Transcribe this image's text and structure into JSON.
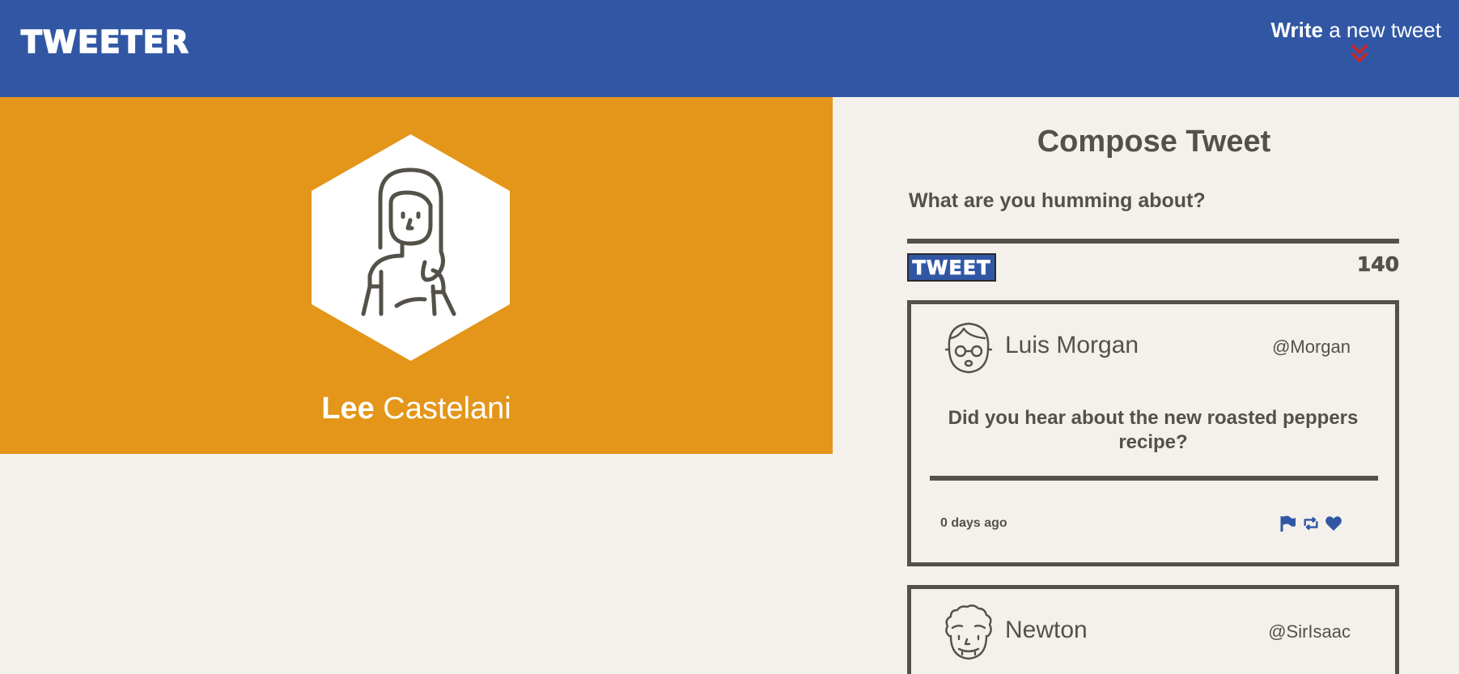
{
  "nav": {
    "brand": "TWEETER",
    "write_strong": "Write",
    "write_rest": " a new tweet"
  },
  "profile": {
    "first_name": "Lee",
    "last_name": " Castelani"
  },
  "compose": {
    "title": "Compose Tweet",
    "label": "What are you humming about?",
    "button_label": "TWEET",
    "counter": "140"
  },
  "tweets": [
    {
      "name": "Luis Morgan",
      "handle": "@Morgan",
      "body": "Did you hear about the new roasted peppers recipe?",
      "time": "0 days ago"
    },
    {
      "name": "Newton",
      "handle": "@SirIsaac"
    }
  ],
  "colors": {
    "nav_bg": "#3157a4",
    "profile_bg": "#e39619",
    "page_bg": "#f4f1ec",
    "text": "#545149",
    "chevron": "#d0232a"
  },
  "icons": [
    "chevron-down-double-icon",
    "flag-icon",
    "retweet-icon",
    "heart-icon"
  ]
}
